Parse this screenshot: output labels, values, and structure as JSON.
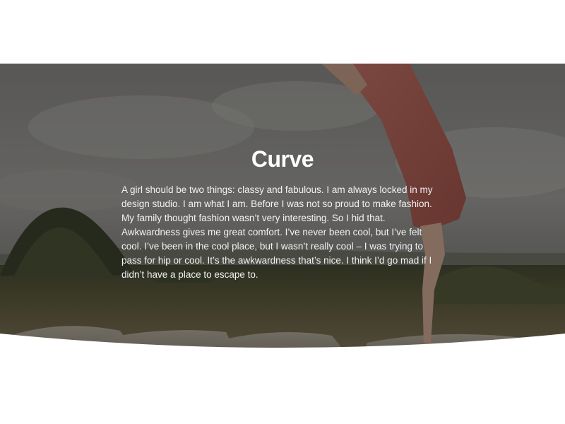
{
  "hero": {
    "title": "Curve",
    "paragraph": "A girl should be two things: classy and fabulous. I am always locked in my design studio. I am what I am. Before I was not so proud to make fashion. My family thought fashion wasn’t very interesting. So I hid that. Awkwardness gives me great comfort. I’ve never been cool, but I’ve felt cool. I’ve been in the cool place, but I wasn’t really cool – I was trying to pass for hip or cool. It’s the awkwardness that’s nice. I think I’d go mad if I didn’t have a place to escape to.",
    "overlay_color": "#000000",
    "background_color": "#ffffff",
    "text_color": "#ffffff"
  }
}
